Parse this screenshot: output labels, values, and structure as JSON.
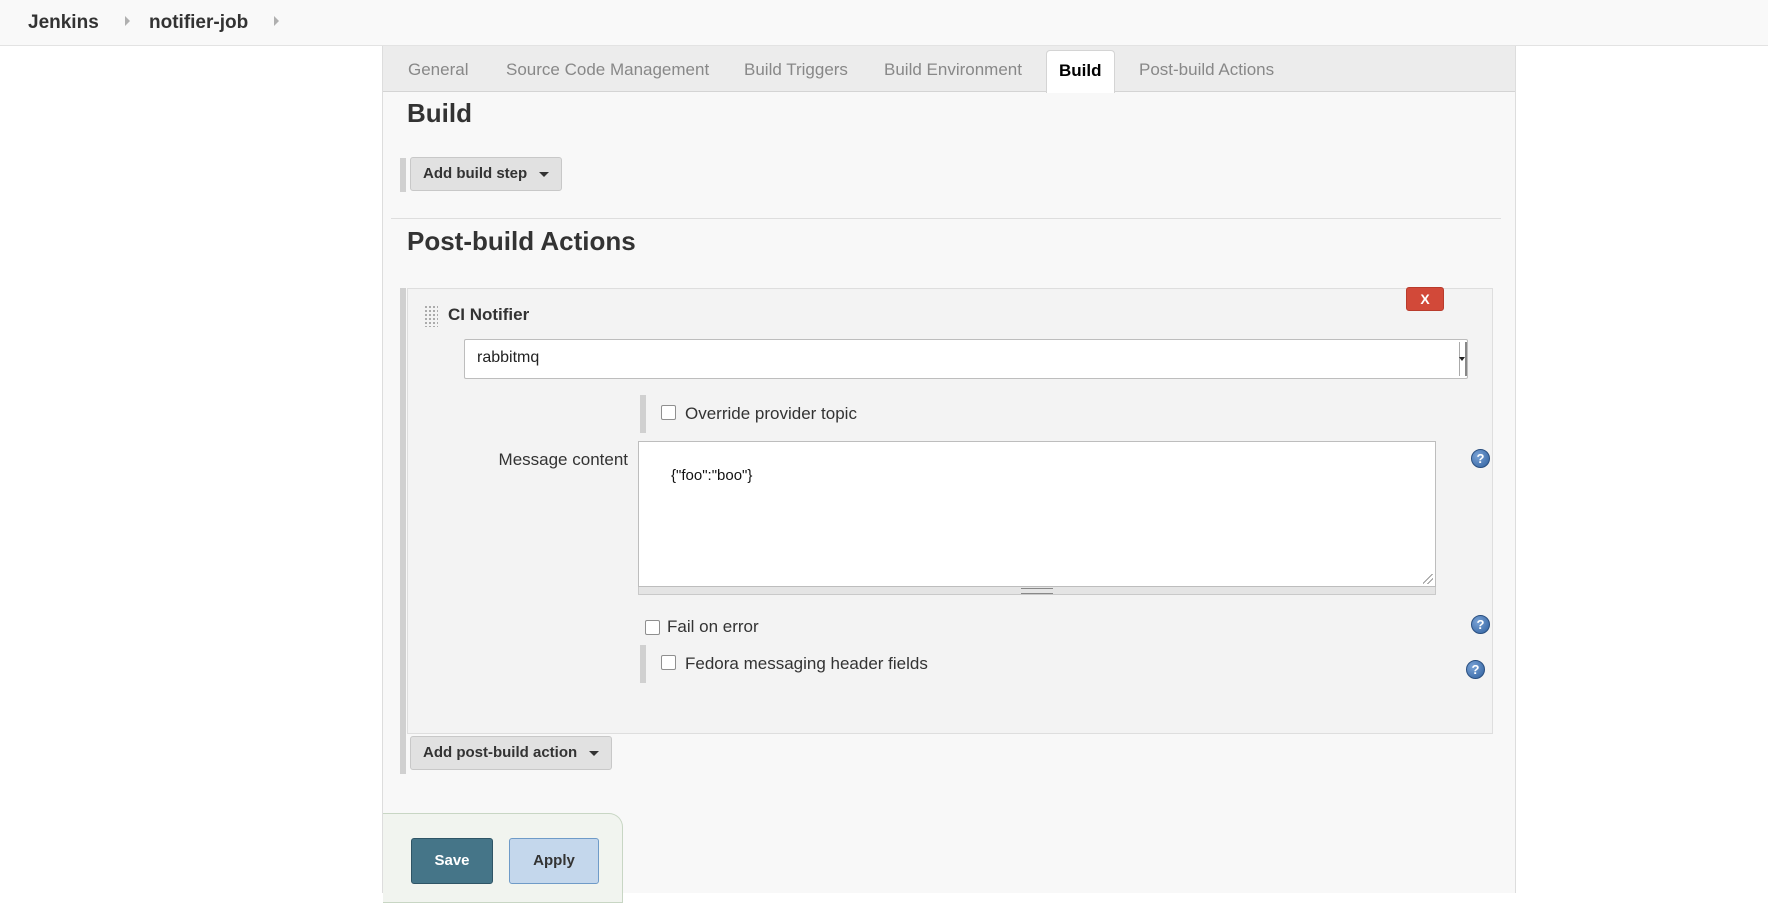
{
  "breadcrumb": {
    "items": [
      "Jenkins",
      "notifier-job"
    ],
    "separator_icon": "chevron-right-icon"
  },
  "tabs": [
    {
      "label": "General",
      "active": false
    },
    {
      "label": "Source Code Management",
      "active": false
    },
    {
      "label": "Build Triggers",
      "active": false
    },
    {
      "label": "Build Environment",
      "active": false
    },
    {
      "label": "Build",
      "active": true
    },
    {
      "label": "Post-build Actions",
      "active": false
    }
  ],
  "build": {
    "title": "Build",
    "add_step_label": "Add build step"
  },
  "post_build": {
    "title": "Post-build Actions",
    "add_action_label": "Add post-build action",
    "ci_notifier": {
      "title": "CI Notifier",
      "delete_label": "X",
      "provider_selected": "rabbitmq",
      "override_topic_label": "Override provider topic",
      "override_topic_checked": false,
      "message_content_label": "Message content",
      "message_content_value": "{\"foo\":\"boo\"}",
      "fail_on_error_label": "Fail on error",
      "fail_on_error_checked": false,
      "fedora_headers_label": "Fedora messaging header fields",
      "fedora_headers_checked": false,
      "help_icon_glyph": "?"
    }
  },
  "actions": {
    "save_label": "Save",
    "apply_label": "Apply"
  },
  "colors": {
    "delete_red": "#d24939",
    "save_teal": "#457588",
    "apply_blue": "#c4d7ec",
    "help_blue": "#2e5f9e"
  }
}
